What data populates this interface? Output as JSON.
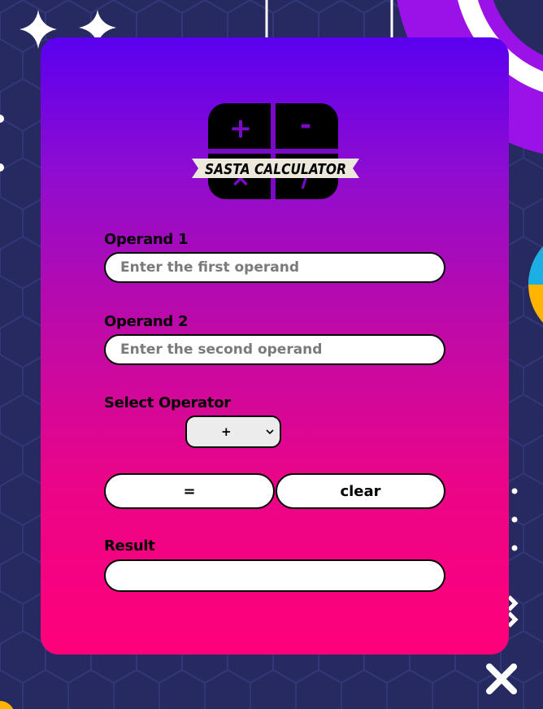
{
  "logo": {
    "text": "SASTA CALCULATOR",
    "glyphs": [
      "+",
      "-",
      "×",
      "/"
    ]
  },
  "operand1": {
    "label": "Operand 1",
    "placeholder": "Enter the first operand",
    "value": ""
  },
  "operand2": {
    "label": "Operand 2",
    "placeholder": "Enter the second operand",
    "value": ""
  },
  "operator": {
    "label": "Select Operator",
    "selected": "+"
  },
  "buttons": {
    "equals": "=",
    "clear": "clear"
  },
  "result": {
    "label": "Result",
    "value": ""
  },
  "colors": {
    "background": "#272a60",
    "card_top": "#5a00f0",
    "card_bottom": "#ff007a",
    "accent_purple": "#9b12e8",
    "accent_yellow": "#ffb400",
    "accent_cyan": "#1ab0e6"
  },
  "icons": [
    "sparkle-icon",
    "close-x-icon",
    "chevron-down-icon"
  ]
}
